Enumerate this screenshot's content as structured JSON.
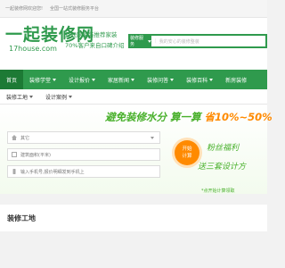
{
  "topbar": {
    "welcome": "一起装修网欢迎您!",
    "link": "全国一站式装修服务平台"
  },
  "header": {
    "logo_cn": "一起装修网",
    "logo_en": "17house.com",
    "slogan_1": "互联网家装推荐家装",
    "slogan_2": "70%客户来自口碑介绍",
    "search_category": "装修服务",
    "search_placeholder": "我的安心的装修整装"
  },
  "nav": {
    "items": [
      {
        "label": "首页",
        "arrow": false
      },
      {
        "label": "装修学堂",
        "arrow": true
      },
      {
        "label": "设计报价",
        "arrow": true
      },
      {
        "label": "家居新闻",
        "arrow": true
      },
      {
        "label": "装修问答",
        "arrow": true
      },
      {
        "label": "装修百科",
        "arrow": true
      },
      {
        "label": "新房装修",
        "arrow": false
      }
    ]
  },
  "subnav": {
    "items": [
      {
        "label": "装修工地"
      },
      {
        "label": "设计案例"
      }
    ]
  },
  "banner": {
    "headline_prefix": "避免装修水分 算一算 ",
    "headline_highlight": "省10%~50%",
    "field_1": "其它",
    "field_2": "建筑面积(平米)",
    "field_3": "输入手机号,报价明细发到手机上",
    "calc_button_1": "开始",
    "calc_button_2": "计算",
    "side_text_1": "粉丝福利",
    "side_text_2": "送三套设计方",
    "side_link": "*点开始计算领取"
  },
  "section": {
    "title": "装修工地"
  },
  "colors": {
    "brand_green": "#2f9a4d",
    "accent_orange": "#ff8a00",
    "light_green": "#48b02b"
  }
}
